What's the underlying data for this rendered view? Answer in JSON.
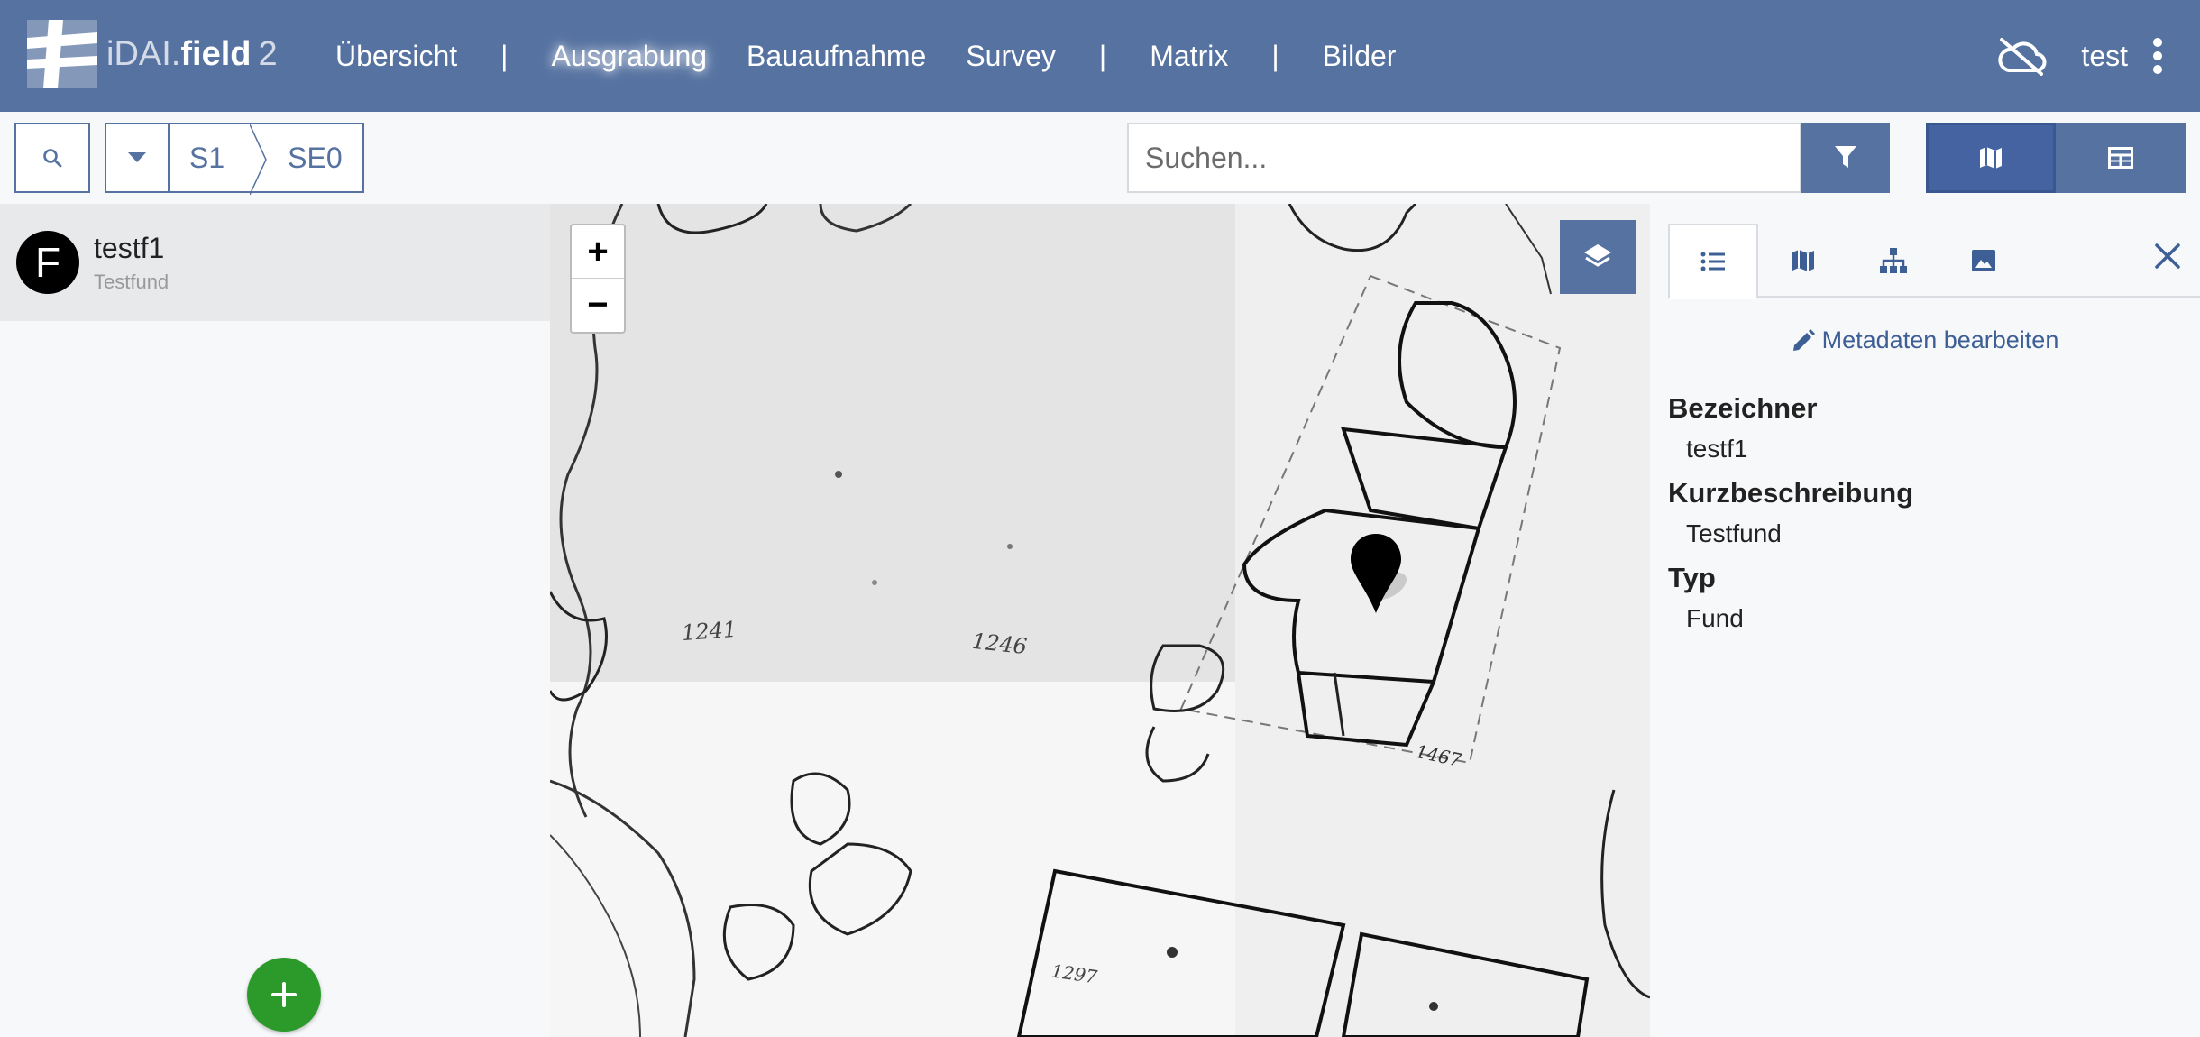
{
  "app": {
    "logo_prefix": "iDAI.",
    "logo_name": "field",
    "logo_version": "2",
    "nav": [
      {
        "label": "Übersicht"
      },
      {
        "label": "Ausgrabung",
        "active": true
      },
      {
        "label": "Bauaufnahme"
      },
      {
        "label": "Survey"
      },
      {
        "label": "Matrix"
      },
      {
        "label": "Bilder"
      }
    ],
    "nav_separator": "|",
    "sync_icon": "cloud-off-icon",
    "user": "test",
    "menu_icon": "more-vertical-icon"
  },
  "toolbar": {
    "search_icon": "search-icon",
    "breadcrumb": [
      "S1",
      "SE0"
    ],
    "search_placeholder": "Suchen...",
    "filter_icon": "filter-icon",
    "views": [
      {
        "icon": "map-icon",
        "active": true
      },
      {
        "icon": "table-icon",
        "active": false
      }
    ]
  },
  "list": {
    "items": [
      {
        "avatar_letter": "F",
        "title": "testf1",
        "subtitle": "Testfund"
      }
    ],
    "add_icon": "plus-icon"
  },
  "map": {
    "zoom_in": "+",
    "zoom_out": "−",
    "layers_icon": "layers-icon",
    "marker_icon": "map-marker-icon",
    "plan_labels": [
      "1241",
      "1246",
      "1467",
      "1297"
    ]
  },
  "sidebar": {
    "tabs": [
      {
        "icon": "list-icon",
        "active": true
      },
      {
        "icon": "map-icon"
      },
      {
        "icon": "hierarchy-icon"
      },
      {
        "icon": "image-icon"
      }
    ],
    "close_icon": "close-icon",
    "edit_label": "Metadaten bearbeiten",
    "fields": [
      {
        "label": "Bezeichner",
        "value": "testf1"
      },
      {
        "label": "Kurzbeschreibung",
        "value": "Testfund"
      },
      {
        "label": "Typ",
        "value": "Fund"
      }
    ]
  },
  "colors": {
    "primary": "#5572a1",
    "add_button": "#2b9a2b",
    "link": "#3d5f95"
  }
}
